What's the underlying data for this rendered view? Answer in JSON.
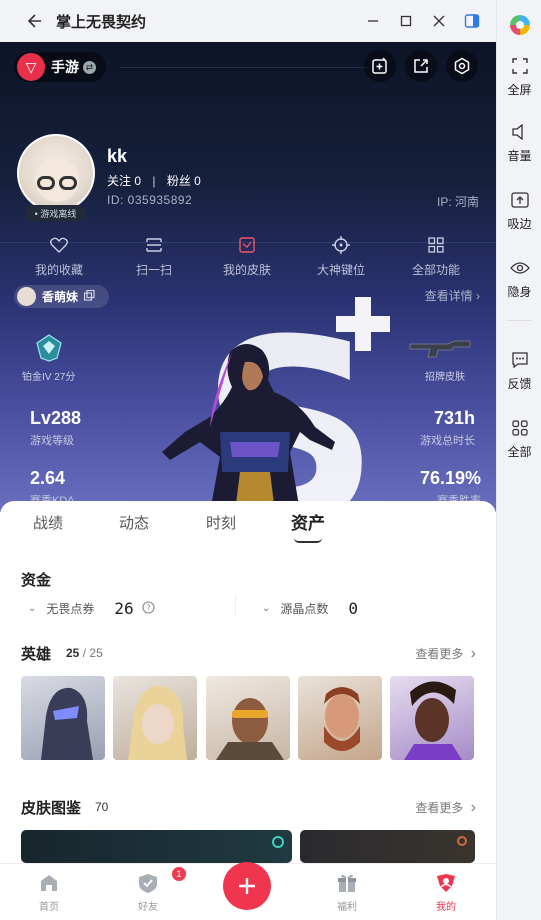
{
  "window": {
    "title": "掌上无畏契约"
  },
  "sidebar": {
    "items": [
      {
        "label": "全屏",
        "icon": "fullscreen-icon"
      },
      {
        "label": "音量",
        "icon": "volume-icon"
      },
      {
        "label": "吸边",
        "icon": "dock-edge-icon"
      },
      {
        "label": "隐身",
        "icon": "eye-icon"
      },
      {
        "label": "反馈",
        "icon": "feedback-icon"
      },
      {
        "label": "全部",
        "icon": "grid-icon"
      }
    ]
  },
  "hero": {
    "brand": "手游",
    "username": "kk",
    "follow": "关注 0",
    "fans": "粉丝 0",
    "separator": "|",
    "uid": "ID:  035935892",
    "ip": "IP:  河南",
    "status": "• 游戏离线",
    "quick_actions": [
      {
        "label": "我的收藏",
        "icon": "heart-icon"
      },
      {
        "label": "扫一扫",
        "icon": "scan-icon"
      },
      {
        "label": "我的皮肤",
        "icon": "skin-icon"
      },
      {
        "label": "大神键位",
        "icon": "crosshair-icon"
      },
      {
        "label": "全部功能",
        "icon": "grid-icon"
      }
    ],
    "tag_name": "香萌妹",
    "detail_link": "查看详情",
    "rank": "铂金IV 27分",
    "skin_label": "招牌皮肤",
    "stats": {
      "level_value": "Lv288",
      "level_label": "游戏等级",
      "hours_value": "731h",
      "hours_label": "游戏总时长",
      "kda_value": "2.64",
      "kda_label": "赛季KDA",
      "win_value": "76.19%",
      "win_label": "赛季胜率"
    }
  },
  "tabs": [
    "战绩",
    "动态",
    "时刻",
    "资产"
  ],
  "active_tab": "资产",
  "assets": {
    "funds_title": "资金",
    "vp_label": "无畏点券",
    "vp_value": "26",
    "rp_label": "源晶点数",
    "rp_value": "0",
    "agents_title": "英雄",
    "agents_count": "25",
    "agents_sep": "/",
    "agents_total": "25",
    "agents_more": "查看更多",
    "skins_title": "皮肤图鉴",
    "skins_count": "70",
    "skins_more": "查看更多"
  },
  "bottom_nav": {
    "items": [
      {
        "label": "首页",
        "icon": "home-icon"
      },
      {
        "label": "好友",
        "icon": "friends-icon",
        "badge": "1"
      },
      {
        "label": "福利",
        "icon": "gift-icon"
      },
      {
        "label": "我的",
        "icon": "profile-icon"
      }
    ],
    "active": "我的",
    "accent": "#f0354e"
  }
}
